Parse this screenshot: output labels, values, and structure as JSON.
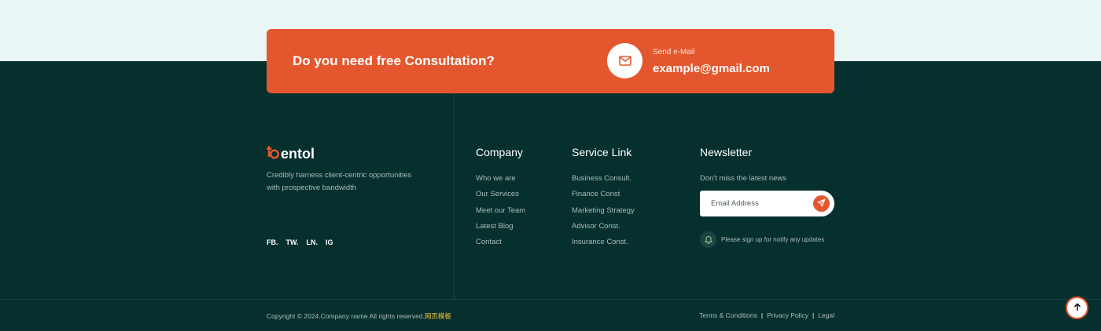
{
  "cta": {
    "title": "Do you need free Consultation?",
    "mail_label": "Send e-Mail",
    "mail": "example@gmail.com"
  },
  "brand": {
    "name": "entol",
    "tagline": "Credibly harness client-centric opportunities with prospective bandwidth",
    "socials": [
      "FB.",
      "TW.",
      "LN.",
      "IG"
    ]
  },
  "company": {
    "title": "Company",
    "links": [
      "Who we are",
      "Our Services",
      "Meet our Team",
      "Latest Blog",
      "Contact"
    ]
  },
  "services": {
    "title": "Service Link",
    "links": [
      "Business Consult.",
      "Finance Const",
      "Marketing Strategy",
      "Advisor Const.",
      "Insurance Const."
    ]
  },
  "newsletter": {
    "title": "Newsletter",
    "subtitle": "Don't miss the latest news",
    "placeholder": "Email Address",
    "notify": "Please sign up for notify any updates"
  },
  "footer": {
    "copyright": "Copyright © 2024.Company name All rights reserved.",
    "copyright_link": "网页模板",
    "legal": [
      "Terms & Conditions",
      "Privacy Policy",
      "Legal"
    ],
    "separator": "|"
  },
  "colors": {
    "accent": "#e4572e",
    "footer_bg": "#06302e",
    "top_band": "#eaf5f5"
  },
  "icons": {
    "cta": "mail-icon",
    "logo": "logo-mark-icon",
    "newsletter_button": "send-icon",
    "notify": "bell-icon",
    "back_to_top": "arrow-up-icon"
  }
}
